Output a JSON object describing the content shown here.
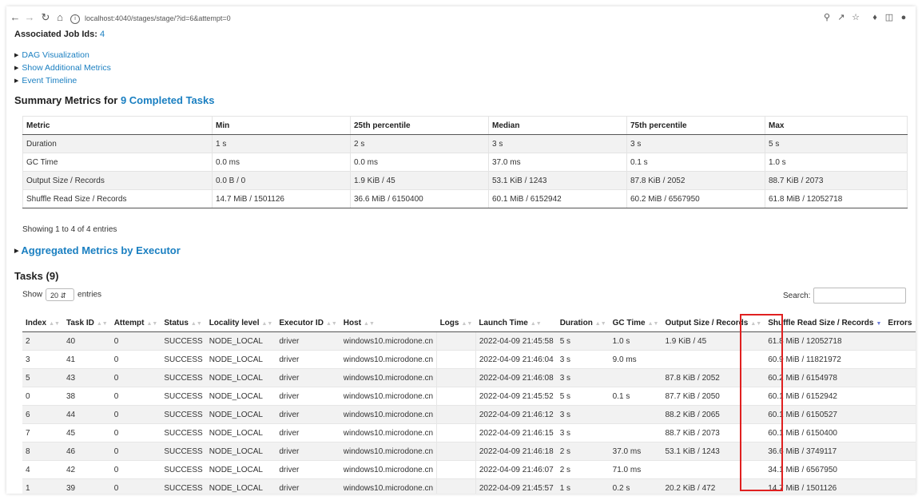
{
  "browser": {
    "url": "localhost:4040/stages/stage/?id=6&attempt=0"
  },
  "stage": {
    "job_ids_label": "Associated Job Ids:",
    "job_ids_value": "4",
    "expanders": [
      "DAG Visualization",
      "Show Additional Metrics",
      "Event Timeline"
    ]
  },
  "summary": {
    "title_prefix": "Summary Metrics for",
    "title_link": "9 Completed Tasks",
    "headers": [
      "Metric",
      "Min",
      "25th percentile",
      "Median",
      "75th percentile",
      "Max"
    ],
    "rows": [
      [
        "Duration",
        "1 s",
        "2 s",
        "3 s",
        "3 s",
        "5 s"
      ],
      [
        "GC Time",
        "0.0 ms",
        "0.0 ms",
        "37.0 ms",
        "0.1 s",
        "1.0 s"
      ],
      [
        "Output Size / Records",
        "0.0 B / 0",
        "1.9 KiB / 45",
        "53.1 KiB / 1243",
        "87.8 KiB / 2052",
        "88.7 KiB / 2073"
      ],
      [
        "Shuffle Read Size / Records",
        "14.7 MiB / 1501126",
        "36.6 MiB / 6150400",
        "60.1 MiB / 6152942",
        "60.2 MiB / 6567950",
        "61.8 MiB / 12052718"
      ]
    ],
    "showing": "Showing 1 to 4 of 4 entries"
  },
  "aggregated": {
    "label": "Aggregated Metrics by Executor"
  },
  "tasks": {
    "title": "Tasks (9)",
    "show_label": "Show",
    "page_size": "20",
    "entries_label": "entries",
    "search_label": "Search:",
    "search_value": "",
    "headers": [
      "Index",
      "Task ID",
      "Attempt",
      "Status",
      "Locality level",
      "Executor ID",
      "Host",
      "Logs",
      "Launch Time",
      "Duration",
      "GC Time",
      "Output Size / Records",
      "Shuffle Read Size / Records",
      "Errors"
    ],
    "rows": [
      [
        "2",
        "40",
        "0",
        "SUCCESS",
        "NODE_LOCAL",
        "driver",
        "windows10.microdone.cn",
        "",
        "2022-04-09 21:45:58",
        "5 s",
        "1.0 s",
        "1.9 KiB / 45",
        "61.8 MiB / 12052718",
        ""
      ],
      [
        "3",
        "41",
        "0",
        "SUCCESS",
        "NODE_LOCAL",
        "driver",
        "windows10.microdone.cn",
        "",
        "2022-04-09 21:46:04",
        "3 s",
        "9.0 ms",
        "",
        "60.9 MiB / 11821972",
        ""
      ],
      [
        "5",
        "43",
        "0",
        "SUCCESS",
        "NODE_LOCAL",
        "driver",
        "windows10.microdone.cn",
        "",
        "2022-04-09 21:46:08",
        "3 s",
        "",
        "87.8 KiB / 2052",
        "60.2 MiB / 6154978",
        ""
      ],
      [
        "0",
        "38",
        "0",
        "SUCCESS",
        "NODE_LOCAL",
        "driver",
        "windows10.microdone.cn",
        "",
        "2022-04-09 21:45:52",
        "5 s",
        "0.1 s",
        "87.7 KiB / 2050",
        "60.1 MiB / 6152942",
        ""
      ],
      [
        "6",
        "44",
        "0",
        "SUCCESS",
        "NODE_LOCAL",
        "driver",
        "windows10.microdone.cn",
        "",
        "2022-04-09 21:46:12",
        "3 s",
        "",
        "88.2 KiB / 2065",
        "60.1 MiB / 6150527",
        ""
      ],
      [
        "7",
        "45",
        "0",
        "SUCCESS",
        "NODE_LOCAL",
        "driver",
        "windows10.microdone.cn",
        "",
        "2022-04-09 21:46:15",
        "3 s",
        "",
        "88.7 KiB / 2073",
        "60.1 MiB / 6150400",
        ""
      ],
      [
        "8",
        "46",
        "0",
        "SUCCESS",
        "NODE_LOCAL",
        "driver",
        "windows10.microdone.cn",
        "",
        "2022-04-09 21:46:18",
        "2 s",
        "37.0 ms",
        "53.1 KiB / 1243",
        "36.6 MiB / 3749117",
        ""
      ],
      [
        "4",
        "42",
        "0",
        "SUCCESS",
        "NODE_LOCAL",
        "driver",
        "windows10.microdone.cn",
        "",
        "2022-04-09 21:46:07",
        "2 s",
        "71.0 ms",
        "",
        "34.1 MiB / 6567950",
        ""
      ],
      [
        "1",
        "39",
        "0",
        "SUCCESS",
        "NODE_LOCAL",
        "driver",
        "windows10.microdone.cn",
        "",
        "2022-04-09 21:45:57",
        "1 s",
        "0.2 s",
        "20.2 KiB / 472",
        "14.7 MiB / 1501126",
        ""
      ]
    ]
  },
  "colors": {
    "link": "#1a7fc1",
    "highlight": "#e02020",
    "stripe": "#f2f2f2"
  }
}
